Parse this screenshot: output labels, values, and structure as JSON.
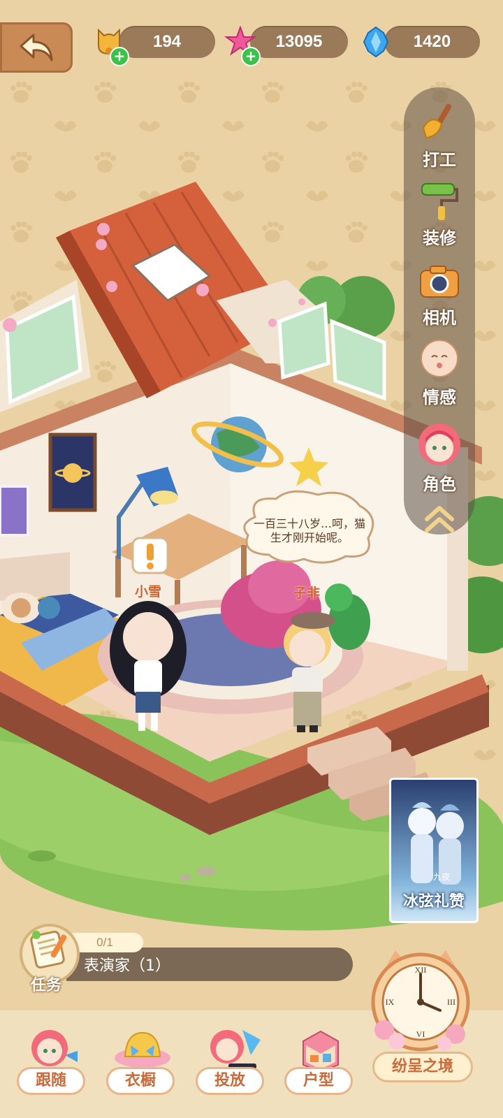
{
  "currencies": [
    {
      "name": "bell",
      "value": "194"
    },
    {
      "name": "pink-gem",
      "value": "13095"
    },
    {
      "name": "blue-crystal",
      "value": "1420"
    }
  ],
  "rail": {
    "items": [
      {
        "id": "work",
        "label": "打工",
        "icon": "feather-duster-icon"
      },
      {
        "id": "decorate",
        "label": "装修",
        "icon": "paint-roller-icon"
      },
      {
        "id": "camera",
        "label": "相机",
        "icon": "camera-icon"
      },
      {
        "id": "emotion",
        "label": "情感",
        "icon": "face-icon"
      },
      {
        "id": "character",
        "label": "角色",
        "icon": "character-portrait-icon"
      }
    ],
    "collapse_icon": "double-chevron-up-icon"
  },
  "scene": {
    "speech": "一百三十八岁…呵，猫生才刚开始呢。",
    "characters": [
      {
        "name": "小雪"
      },
      {
        "name": "子非"
      }
    ]
  },
  "task": {
    "label": "任务",
    "progress": "0/1",
    "text": "表演家（1）"
  },
  "banner": {
    "title": "冰弦礼赞",
    "subtitle": "九夜"
  },
  "bottom_nav": [
    {
      "id": "follow",
      "label": "跟随"
    },
    {
      "id": "wardrobe",
      "label": "衣橱"
    },
    {
      "id": "place",
      "label": "投放"
    },
    {
      "id": "layout",
      "label": "户型"
    }
  ],
  "clock_button": {
    "label": "纷呈之境"
  },
  "colors": {
    "background": "#ead2a5",
    "pill": "#9a7a58",
    "accent_label": "#c96a3a",
    "grass": "#8ac35a"
  }
}
